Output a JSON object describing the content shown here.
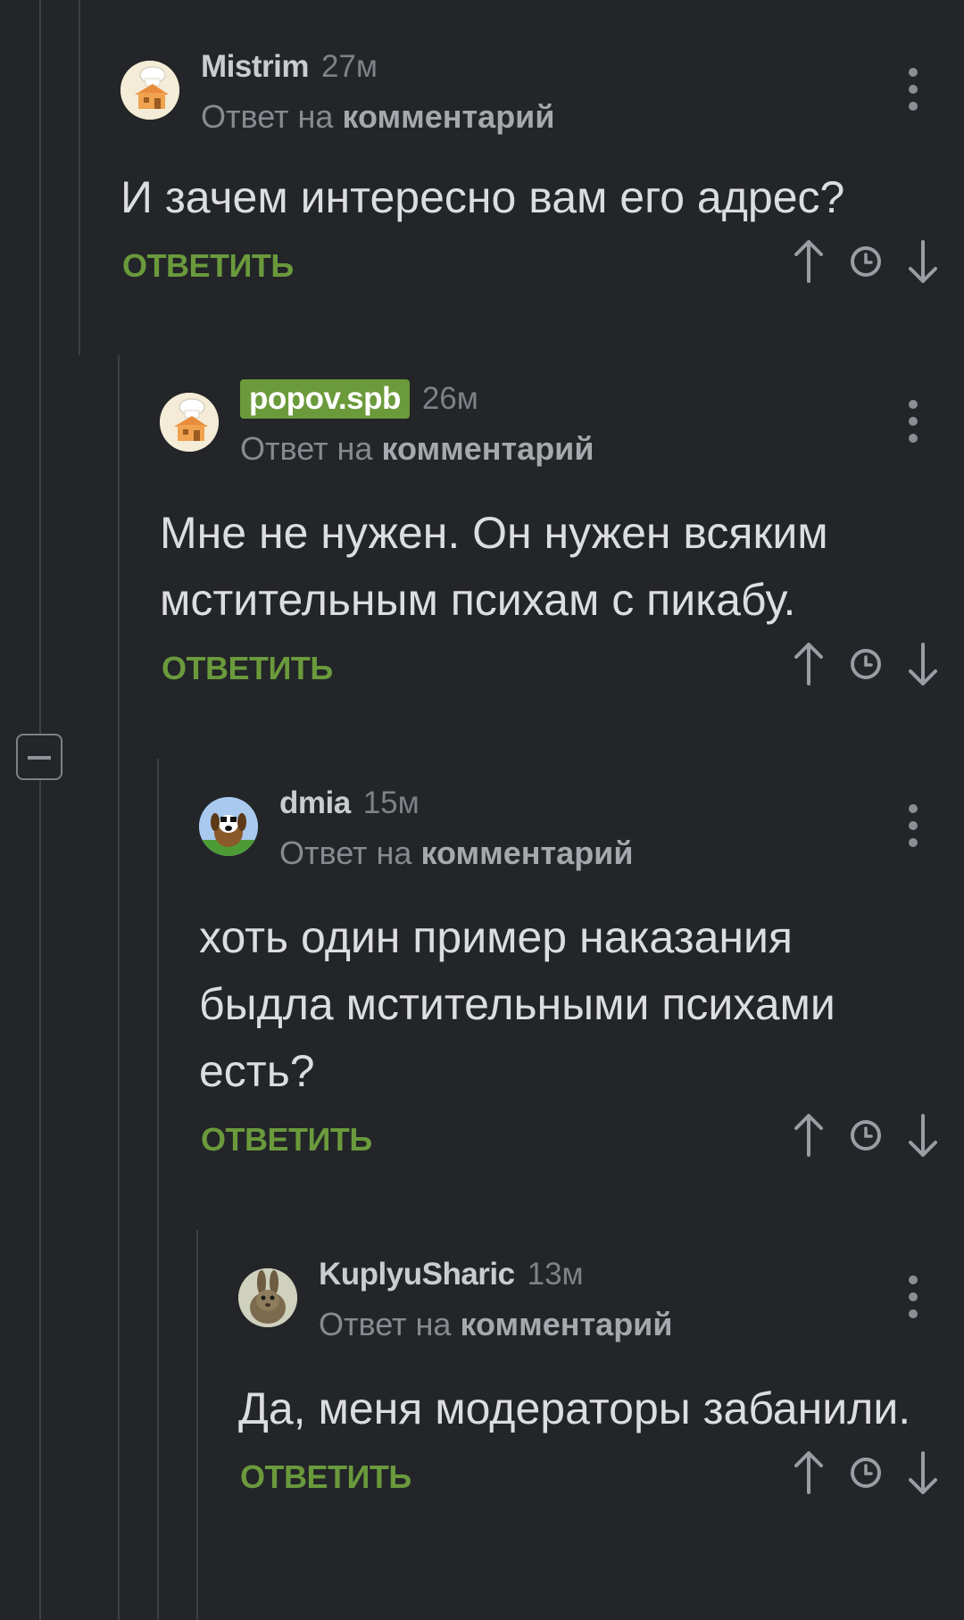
{
  "colors": {
    "background": "#232528",
    "reply_button": "#6a9a3c",
    "highlight_badge": "#6b9a3b",
    "thread_line": "#3d4044"
  },
  "comments": [
    {
      "username": "Mistrim",
      "time": "27м",
      "reply_prefix": "Ответ на",
      "reply_target": "комментарий",
      "body": "И зачем интересно вам его адрес?",
      "reply_label": "ОТВЕТИТЬ",
      "avatar_icon": "chef-house-avatar-icon"
    },
    {
      "username": "popov.spb",
      "time": "26м",
      "reply_prefix": "Ответ на",
      "reply_target": "комментарий",
      "body": "Мне не нужен. Он нужен всяким мстительным психам с пикабу.",
      "reply_label": "ОТВЕТИТЬ",
      "avatar_icon": "chef-house-avatar-icon"
    },
    {
      "username": "dmia",
      "time": "15м",
      "reply_prefix": "Ответ на",
      "reply_target": "комментарий",
      "body": "хоть один пример наказания быдла мстительными психами есть?",
      "reply_label": "ОТВЕТИТЬ",
      "avatar_icon": "dog-avatar-icon"
    },
    {
      "username": "KuplyuSharic",
      "time": "13м",
      "reply_prefix": "Ответ на",
      "reply_target": "комментарий",
      "body": "Да, меня модераторы забанили.",
      "reply_label": "ОТВЕТИТЬ",
      "avatar_icon": "hare-avatar-icon"
    }
  ]
}
